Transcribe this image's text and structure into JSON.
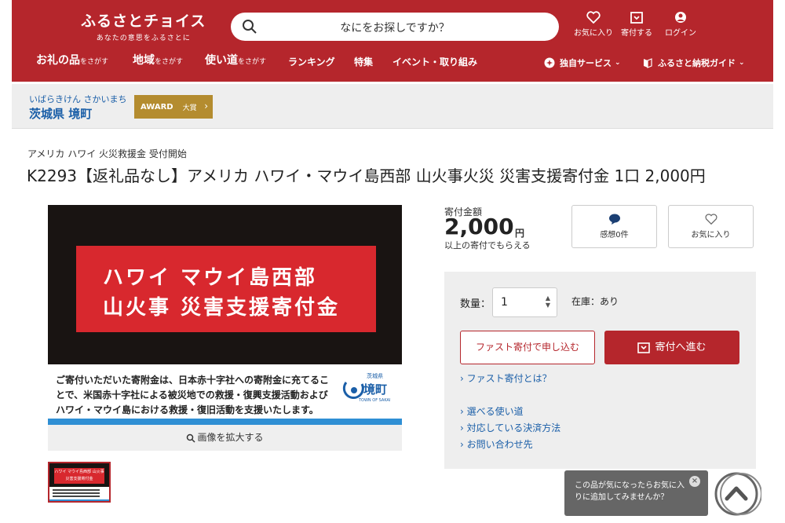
{
  "header": {
    "logo_title": "ふるさとチョイス",
    "logo_tagline": "あなたの意思をふるさとに",
    "search_placeholder": "なにをお探しですか？",
    "utility": [
      {
        "label": "お気に入り",
        "icon": "heart-icon"
      },
      {
        "label": "寄付する",
        "icon": "donate-box-icon"
      },
      {
        "label": "ログイン",
        "icon": "user-icon"
      }
    ],
    "nav": [
      {
        "main": "お礼の品",
        "sub": "をさがす"
      },
      {
        "main": "地域",
        "sub": "をさがす"
      },
      {
        "main": "使い道",
        "sub": "をさがす"
      },
      {
        "main": "ランキング",
        "sub": ""
      },
      {
        "main": "特集",
        "sub": ""
      },
      {
        "main": "イベント・取り組み",
        "sub": ""
      }
    ],
    "nav_right": [
      {
        "label": "独自サービス",
        "icon": "sparkle-icon"
      },
      {
        "label": "ふるさと納税ガイド",
        "icon": "book-icon"
      }
    ]
  },
  "municipality": {
    "kana": "いばらきけん さかいまち",
    "name": "茨城県 境町",
    "award_label": "AWARD",
    "award_rank": "大賞"
  },
  "product": {
    "category": "アメリカ ハワイ 火災救援金 受付開始",
    "title": "K2293【返礼品なし】アメリカ ハワイ・マウイ島西部 山火事火災 災害支援寄付金 1口 2,000円",
    "image": {
      "headline_1": "ハワイ マウイ島西部",
      "headline_2": "山火事 災害支援寄付金",
      "note_lines": [
        "ご寄付いただいた寄附金は、日本赤十字社への寄附金に充てるこ",
        "とで、米国赤十字社による被災地での救援・復興支援活動および",
        "ハワイ・マウイ島における救援・復旧活動を支援いたします。"
      ],
      "town_logo_pref": "茨城県",
      "town_logo_name": "境町",
      "town_logo_en": "TOWN OF SAKAI"
    },
    "zoom_label": "画像を拡大する",
    "thumbnail_headline": "ハワイ マウイ島西部 山火事 災害支援寄付金"
  },
  "price": {
    "label": "寄付金額",
    "amount": "2,000",
    "unit": "円",
    "note": "以上の寄付でもらえる",
    "review_label": "感想0件",
    "favorite_label": "お気に入り"
  },
  "purchase": {
    "qty_label": "数量：",
    "qty_value": "1",
    "stock_text": "在庫：あり",
    "fast_button": "ファスト寄付で申し込む",
    "donate_button": "寄付へ進む",
    "fast_link": "ファスト寄付とは？",
    "links": [
      "選べる使い道",
      "対応している決済方法",
      "お問い合わせ先"
    ]
  },
  "popup": {
    "text_line_1": "この品が気になったらお気に入",
    "text_line_2": "りに追加してみませんか？",
    "close": "×"
  },
  "colors": {
    "brand_red": "#b5262c",
    "link_blue": "#1b5fa8",
    "award_gold": "#b48c2f"
  }
}
